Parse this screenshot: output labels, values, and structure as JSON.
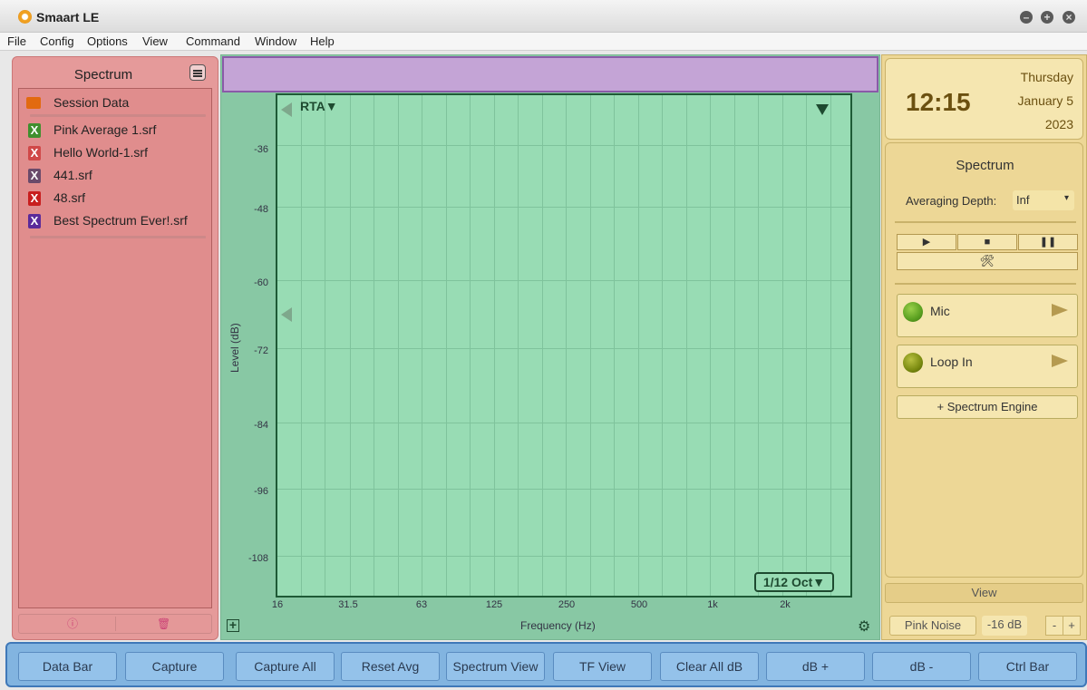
{
  "app": {
    "title": "Smaart LE"
  },
  "menu": [
    "File",
    "Config",
    "Options",
    "View",
    "Command",
    "Window",
    "Help"
  ],
  "left_panel": {
    "title": "Spectrum",
    "folder": "Session Data",
    "files": [
      {
        "name": "Pink Average 1.srf",
        "color": "#3f8f2e"
      },
      {
        "name": "Hello World-1.srf",
        "color": "#d04848"
      },
      {
        "name": "441.srf",
        "color": "#6a4a6a"
      },
      {
        "name": "48.srf",
        "color": "#c81e1e"
      },
      {
        "name": "Best Spectrum Ever!.srf",
        "color": "#5a2a9a"
      }
    ]
  },
  "plot": {
    "trace_label": "RTA▼",
    "y_axis_label": "Level (dB)",
    "x_axis_label": "Frequency (Hz)",
    "y_ticks": [
      "-36",
      "-48",
      "-60",
      "-72",
      "-84",
      "-96",
      "-108"
    ],
    "x_ticks": [
      "16",
      "31.5",
      "63",
      "125",
      "250",
      "500",
      "1k",
      "2k"
    ],
    "resolution": "1/12 Oct▼"
  },
  "clock": {
    "time": "12:15",
    "day": "Thursday",
    "date": "January 5",
    "year": "2023"
  },
  "spectrum_panel": {
    "title": "Spectrum",
    "averaging_label": "Averaging Depth:",
    "averaging_value": "Inf",
    "channels": [
      {
        "name": "Mic",
        "led": "#5aa020"
      },
      {
        "name": "Loop In",
        "led": "#7a8a10"
      }
    ],
    "engine_button": "+ Spectrum Engine",
    "view_label": "View",
    "pink_noise": "Pink Noise",
    "noise_level": "-16 dB",
    "minus": "-",
    "plus": "+"
  },
  "bottom_bar": [
    "Data Bar",
    "Capture",
    "Capture All",
    "Reset Avg",
    "Spectrum View",
    "TF View",
    "Clear All dB",
    "dB +",
    "dB -",
    "Ctrl Bar"
  ]
}
